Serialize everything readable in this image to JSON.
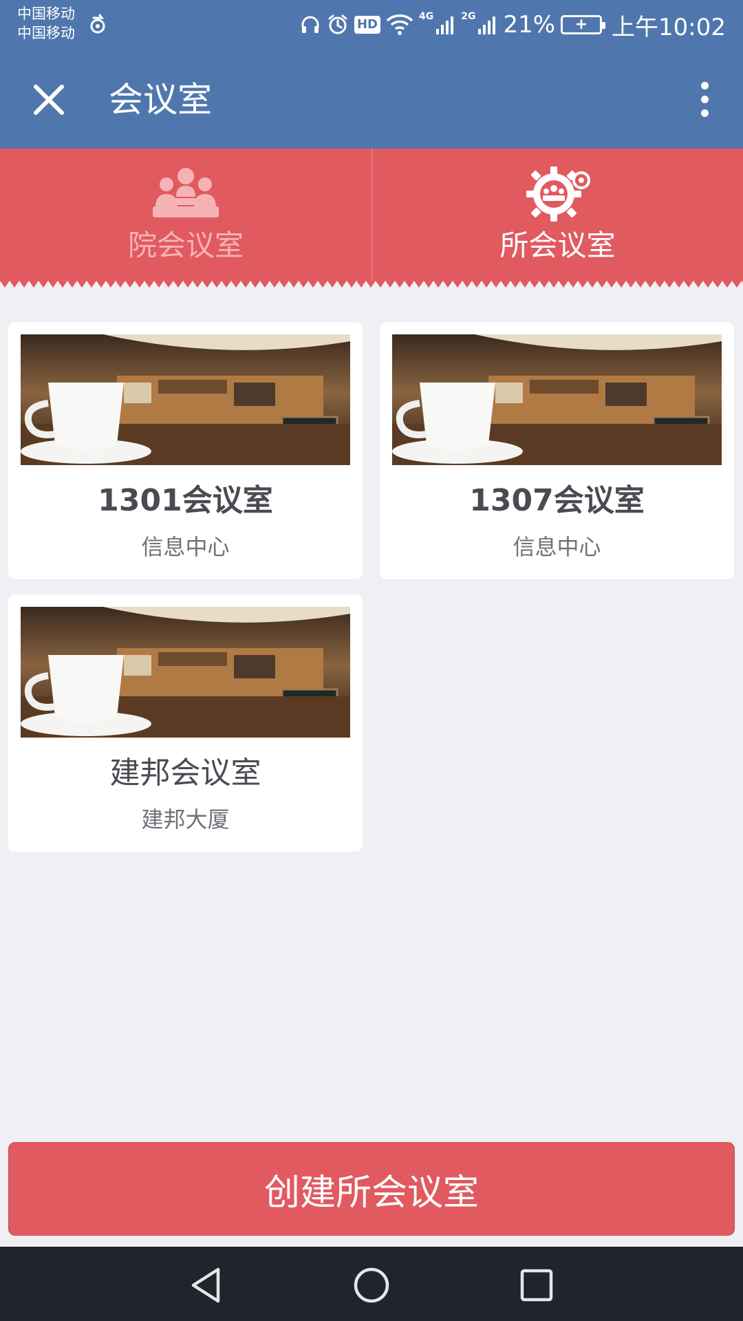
{
  "status_bar": {
    "carrier_1": "中国移动",
    "carrier_2": "中国移动",
    "hd_label": "HD",
    "signal_1_label": "4G",
    "signal_2_label": "2G",
    "battery_percent": "21%",
    "time": "上午10:02",
    "icons": [
      "sync-icon",
      "headset-icon",
      "alarm-icon",
      "hd-icon",
      "wifi-icon",
      "signal-icon",
      "battery-icon"
    ]
  },
  "app_bar": {
    "title": "会议室",
    "close_icon": "close-icon",
    "more_icon": "more-vertical-icon"
  },
  "tabs": [
    {
      "label": "院会议室",
      "icon": "meeting-group-icon",
      "active": false
    },
    {
      "label": "所会议室",
      "icon": "meeting-gear-icon",
      "active": true
    }
  ],
  "rooms": [
    {
      "name": "1301会议室",
      "location": "信息中心"
    },
    {
      "name": "1307会议室",
      "location": "信息中心"
    },
    {
      "name": "建邦会议室",
      "location": "建邦大厦"
    }
  ],
  "create_button": {
    "label": "创建所会议室"
  },
  "nav_bar": {
    "icons": [
      "back-icon",
      "home-icon",
      "recents-icon"
    ]
  },
  "colors": {
    "app_bar": "#5077ad",
    "accent": "#e05a60",
    "background": "#efeff4",
    "nav_bar": "#20242d"
  }
}
